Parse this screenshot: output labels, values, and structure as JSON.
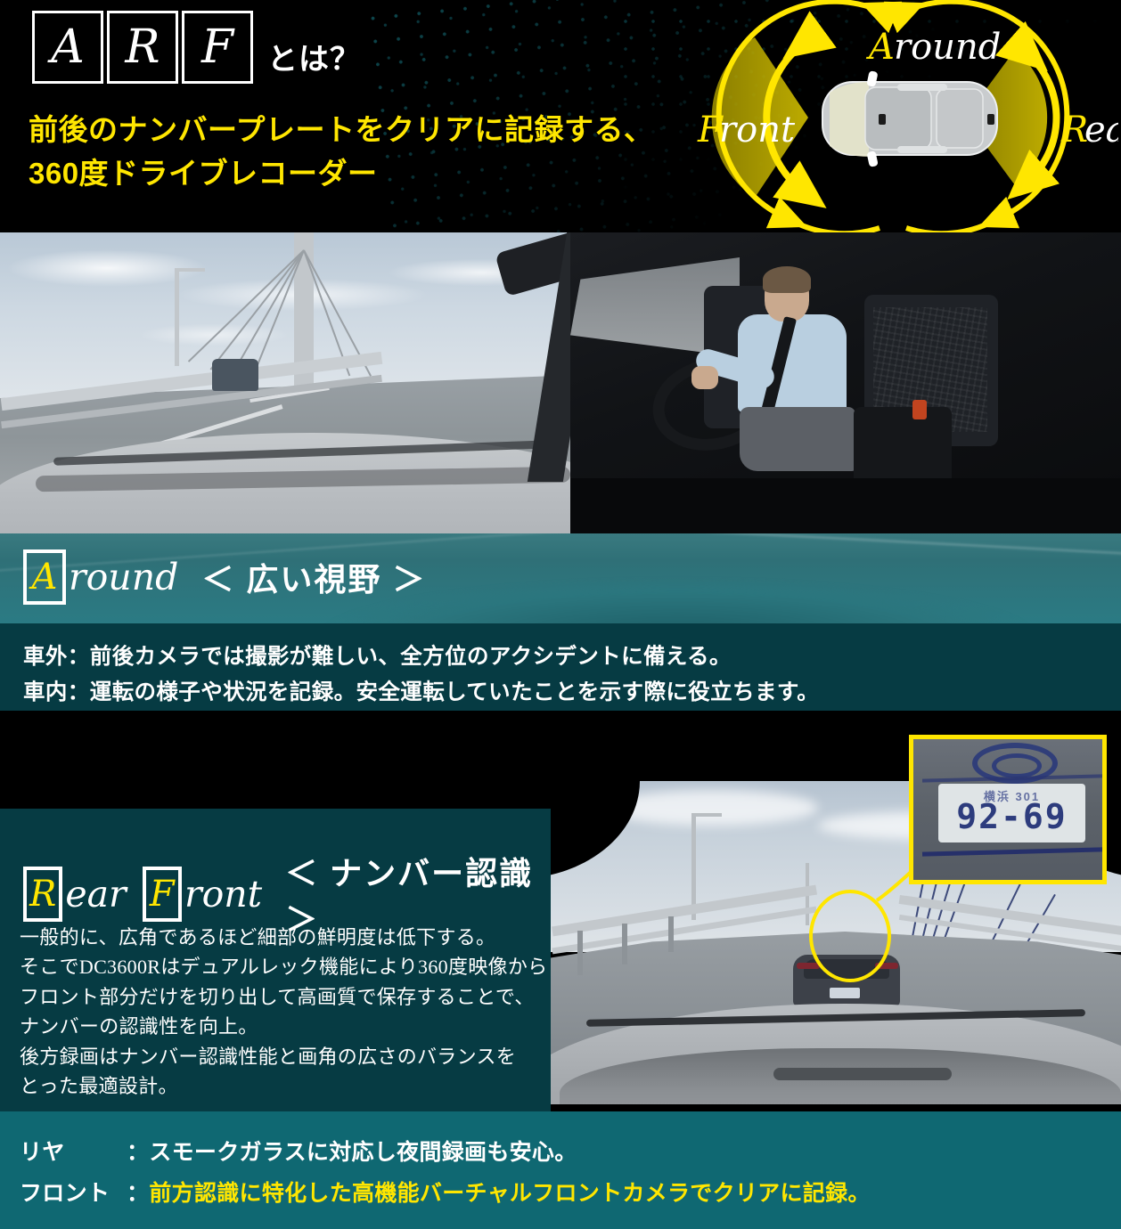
{
  "header": {
    "badge_letters": [
      "A",
      "R",
      "F"
    ],
    "badge_suffix": "とは？",
    "headline_line1": "前後のナンバープレートをクリアに記録する、",
    "headline_line2": "360度ドライブレコーダー",
    "accent_color": "#ffe600",
    "background_color": "#000000"
  },
  "car_diagram": {
    "label_front": {
      "initial": "F",
      "rest": "ront"
    },
    "label_around": {
      "initial": "A",
      "rest": "round"
    },
    "label_rear": {
      "initial": "R",
      "rest": "ear"
    },
    "arrow_color": "#ffe600",
    "car_icon": "car-top-view-icon"
  },
  "section_around": {
    "initial": "A",
    "word": "round",
    "subtitle": "＜ 広い視野 ＞",
    "lines": [
      "車外：前後カメラでは撮影が難しい、全方位のアクシデントに備える。",
      "車内：運転の様子や状況を記録。安全運転していたことを示す際に役立ちます。"
    ],
    "band_color": "#2f7077",
    "text_band_color": "#063b43"
  },
  "section_rear_front": {
    "initial_1": "R",
    "word_1": "ear",
    "initial_2": "F",
    "word_2": "ront",
    "subtitle": "＜ ナンバー認識 ＞",
    "body_lines": [
      "一般的に、広角であるほど細部の鮮明度は低下する。",
      "そこでDC3600Rはデュアルレック機能により360度映像から",
      "フロント部分だけを切り出して高画質で保存することで、",
      "ナンバーの認識性を向上。",
      "後方録画はナンバー認識性能と画角の広さのバランスを",
      "とった最適設計。"
    ],
    "panel_color": "#063b43"
  },
  "photo_front": {
    "caption_alt": "front-dashcam-photo",
    "plate_inset": {
      "region_small_text": "横浜 301",
      "plate_number": "92-69",
      "highlight_color": "#ffe600"
    }
  },
  "photo_360": {
    "caption_alt": "360-degree-interior-photo"
  },
  "bottom_band": {
    "row1_label": "リヤ",
    "row1_sep": "：",
    "row1_text": "スモークガラスに対応し夜間録画も安心。",
    "row2_label": "フロント",
    "row2_sep": "：",
    "row2_text": "前方認識に特化した高機能バーチャルフロントカメラでクリアに記録。",
    "background_color": "#0f6872",
    "highlight_color": "#ffe600"
  }
}
